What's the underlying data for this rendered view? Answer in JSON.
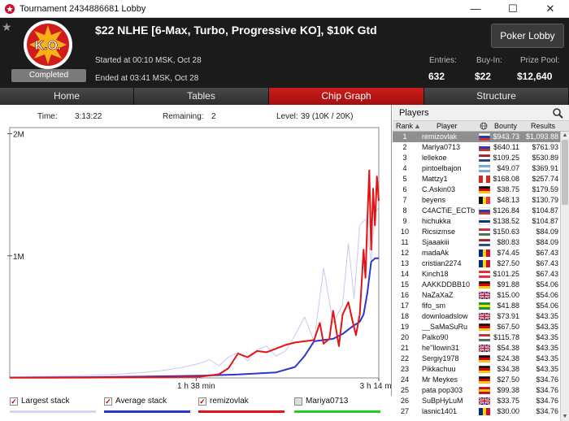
{
  "window": {
    "title": "Tournament 2434886681 Lobby",
    "controls": {
      "minimize": "—",
      "maximize": "☐",
      "close": "✕"
    }
  },
  "header": {
    "logo_text": "K.O.",
    "status": "Completed",
    "tournament_name": "$22 NLHE [6-Max, Turbo, Progressive KO], $10K Gtd",
    "started": "Started at 00:10 MSK, Oct 28",
    "ended": "Ended at 03:41 MSK, Oct 28",
    "lobby_button": "Poker Lobby",
    "stats": [
      {
        "label": "Entries:",
        "value": "632"
      },
      {
        "label": "Buy-In:",
        "value": "$22"
      },
      {
        "label": "Prize Pool:",
        "value": "$12,640"
      }
    ]
  },
  "tabs": [
    {
      "label": "Home",
      "active": false
    },
    {
      "label": "Tables",
      "active": false
    },
    {
      "label": "Chip Graph",
      "active": true
    },
    {
      "label": "Structure",
      "active": false
    }
  ],
  "chart_stats": {
    "time_label": "Time:",
    "time_value": "3:13:22",
    "remaining_label": "Remaining:",
    "remaining_value": "2",
    "level_label": "Level:",
    "level_value": "39 (10K / 20K)"
  },
  "chart_data": {
    "type": "line",
    "title": "",
    "xlabel": "",
    "ylabel": "",
    "x_range_min": [
      0,
      194
    ],
    "y_range": [
      0,
      2050000
    ],
    "y_ticks": [
      {
        "value": 1000000,
        "label": "1M"
      },
      {
        "value": 2000000,
        "label": "2M"
      }
    ],
    "x_ticks": [
      {
        "value": 98,
        "label": "1 h 38 min"
      },
      {
        "value": 194,
        "label": "3 h 14 min"
      }
    ],
    "series": [
      {
        "name": "Largest stack",
        "color": "#c9c9ef",
        "x": [
          0,
          10,
          20,
          30,
          40,
          50,
          60,
          70,
          80,
          90,
          100,
          105,
          110,
          115,
          120,
          125,
          130,
          135,
          140,
          145,
          150,
          155,
          160,
          165,
          170,
          175,
          178,
          181,
          184,
          187,
          190,
          192,
          194
        ],
        "y": [
          5000,
          8000,
          12000,
          15000,
          20000,
          26000,
          34000,
          45000,
          60000,
          85000,
          120000,
          150000,
          100000,
          170000,
          210000,
          140000,
          230000,
          260000,
          180000,
          220000,
          350000,
          500000,
          300000,
          900000,
          450000,
          600000,
          1100000,
          650000,
          1250000,
          1300000,
          950000,
          1350000,
          1400000
        ]
      },
      {
        "name": "Average stack",
        "color": "#2a35d6",
        "x": [
          0,
          20,
          40,
          60,
          80,
          100,
          120,
          140,
          150,
          155,
          160,
          170,
          175,
          180,
          184,
          186,
          188,
          190,
          192,
          194
        ],
        "y": [
          3000,
          4000,
          6000,
          9000,
          13000,
          18000,
          28000,
          45000,
          90000,
          180000,
          300000,
          320000,
          360000,
          420000,
          460000,
          520000,
          700000,
          950000,
          980000,
          980000
        ]
      },
      {
        "name": "remizovlak",
        "color": "#e41414",
        "x": [
          0,
          20,
          40,
          60,
          80,
          90,
          100,
          110,
          115,
          120,
          125,
          130,
          135,
          140,
          145,
          150,
          155,
          160,
          163,
          165,
          168,
          170,
          173,
          175,
          178,
          180,
          182,
          184,
          186,
          187,
          188,
          189,
          190,
          191,
          192,
          193,
          194
        ],
        "y": [
          1000,
          1500,
          2500,
          4000,
          6000,
          8000,
          10000,
          30000,
          80000,
          200000,
          170000,
          220000,
          210000,
          240000,
          270000,
          290000,
          300000,
          310000,
          450000,
          280000,
          320000,
          550000,
          260000,
          520000,
          620000,
          480000,
          350000,
          520000,
          1050000,
          820000,
          1300000,
          1700000,
          1050000,
          1550000,
          1250000,
          1650000,
          1450000
        ]
      },
      {
        "name": "Mariya0713",
        "color": "#22cc22",
        "x": [],
        "y": []
      }
    ]
  },
  "legend": [
    {
      "label": "Largest stack",
      "checked": true,
      "color": "#d6d6f2"
    },
    {
      "label": "Average stack",
      "checked": true,
      "color": "#2a35d6"
    },
    {
      "label": "remizovlak",
      "checked": true,
      "color": "#e41414"
    },
    {
      "label": "Mariya0713",
      "checked": false,
      "color": "#22cc22"
    }
  ],
  "players": {
    "title": "Players",
    "columns": {
      "rank": "Rank",
      "player": "Player",
      "bounty": "Bounty",
      "results": "Results"
    },
    "rows": [
      {
        "rank": "1",
        "name": "remizovlak",
        "flag": "ru",
        "bounty": "$943.73",
        "result": "$1,093.88"
      },
      {
        "rank": "2",
        "name": "Mariya0713",
        "flag": "ru",
        "bounty": "$640.11",
        "result": "$761.93"
      },
      {
        "rank": "3",
        "name": "lellekoe",
        "flag": "nl",
        "bounty": "$109.25",
        "result": "$530.89"
      },
      {
        "rank": "4",
        "name": "pintoelbajon",
        "flag": "ar",
        "bounty": "$49.07",
        "result": "$369.91"
      },
      {
        "rank": "5",
        "name": "Mattzy1",
        "flag": "ca",
        "bounty": "$168.08",
        "result": "$257.74"
      },
      {
        "rank": "6",
        "name": "C.Askin03",
        "flag": "de",
        "bounty": "$38.75",
        "result": "$179.59"
      },
      {
        "rank": "7",
        "name": "beyens",
        "flag": "be",
        "bounty": "$48.13",
        "result": "$130.79"
      },
      {
        "rank": "8",
        "name": "C4ACTiE_ECTb",
        "flag": "ru",
        "bounty": "$126.84",
        "result": "$104.87"
      },
      {
        "rank": "9",
        "name": "hichukka",
        "flag": "fi",
        "bounty": "$138.52",
        "result": "$104.87"
      },
      {
        "rank": "10",
        "name": "Ricsizmse",
        "flag": "hu",
        "bounty": "$150.63",
        "result": "$84.09"
      },
      {
        "rank": "11",
        "name": "Sjaaakiii",
        "flag": "nl",
        "bounty": "$80.83",
        "result": "$84.09"
      },
      {
        "rank": "12",
        "name": "madaAk",
        "flag": "ro",
        "bounty": "$74.45",
        "result": "$67.43"
      },
      {
        "rank": "13",
        "name": "cristian2274",
        "flag": "ro",
        "bounty": "$27.50",
        "result": "$67.43"
      },
      {
        "rank": "14",
        "name": "Kinch18",
        "flag": "at",
        "bounty": "$101.25",
        "result": "$67.43"
      },
      {
        "rank": "15",
        "name": "AAKKDDBB10",
        "flag": "de",
        "bounty": "$91.88",
        "result": "$54.06"
      },
      {
        "rank": "16",
        "name": "NaZaXaZ",
        "flag": "gb",
        "bounty": "$15.00",
        "result": "$54.06"
      },
      {
        "rank": "17",
        "name": "fifo_sm",
        "flag": "br",
        "bounty": "$41.88",
        "result": "$54.06"
      },
      {
        "rank": "18",
        "name": "downloadslow",
        "flag": "gb",
        "bounty": "$73.91",
        "result": "$43.35"
      },
      {
        "rank": "19",
        "name": "__SaMaSuRu",
        "flag": "de",
        "bounty": "$67.50",
        "result": "$43.35"
      },
      {
        "rank": "20",
        "name": "Palko90",
        "flag": "hu",
        "bounty": "$115.78",
        "result": "$43.35"
      },
      {
        "rank": "21",
        "name": "he''llowin31",
        "flag": "gb",
        "bounty": "$54.38",
        "result": "$43.35"
      },
      {
        "rank": "22",
        "name": "Sergiy1978",
        "flag": "de",
        "bounty": "$24.38",
        "result": "$43.35"
      },
      {
        "rank": "23",
        "name": "Pikkachuu",
        "flag": "de",
        "bounty": "$34.38",
        "result": "$43.35"
      },
      {
        "rank": "24",
        "name": "Mr Meykes",
        "flag": "de",
        "bounty": "$27.50",
        "result": "$34.76"
      },
      {
        "rank": "25",
        "name": "pata pop303",
        "flag": "es",
        "bounty": "$99.38",
        "result": "$34.76"
      },
      {
        "rank": "26",
        "name": "SuBpHyLuM",
        "flag": "gb",
        "bounty": "$33.75",
        "result": "$34.76"
      },
      {
        "rank": "27",
        "name": "lasnic1401",
        "flag": "ro",
        "bounty": "$30.00",
        "result": "$34.76"
      }
    ]
  }
}
